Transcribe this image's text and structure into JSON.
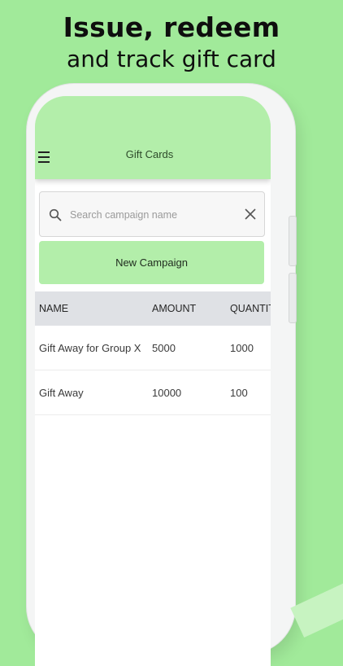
{
  "headline": {
    "line1": "Issue, redeem",
    "line2": "and track gift card"
  },
  "app": {
    "title": "Gift Cards",
    "menu_icon": "hamburger-menu-icon"
  },
  "search": {
    "placeholder": "Search campaign name",
    "value": "",
    "icon": "search-icon",
    "clear_icon": "close-icon"
  },
  "new_campaign": {
    "label": "New Campaign"
  },
  "table": {
    "columns": [
      "NAME",
      "AMOUNT",
      "QUANTITY"
    ],
    "rows": [
      {
        "name": "Gift Away for Group X",
        "amount": "5000",
        "quantity": "1000"
      },
      {
        "name": "Gift Away",
        "amount": "10000",
        "quantity": "100"
      }
    ]
  },
  "colors": {
    "background": "#a1ea9a",
    "app_bar": "#b3eeaa",
    "table_header": "#dfe1e5"
  }
}
